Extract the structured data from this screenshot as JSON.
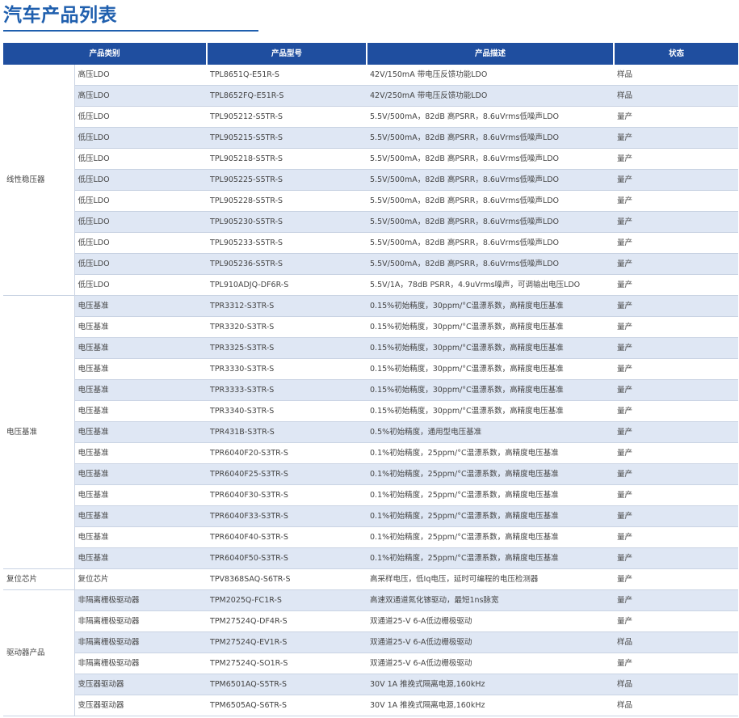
{
  "page_title": "汽车产品列表",
  "header": {
    "category": "产品类别",
    "model": "产品型号",
    "description": "产品描述",
    "status": "状态"
  },
  "groups": [
    {
      "category": "线性稳压器",
      "rows": [
        {
          "sub": "高压LDO",
          "model": "TPL8651Q-E51R-S",
          "desc": "42V/150mA 带电压反馈功能LDO",
          "status": "样品"
        },
        {
          "sub": "高压LDO",
          "model": "TPL8652FQ-E51R-S",
          "desc": "42V/250mA 带电压反馈功能LDO",
          "status": "样品"
        },
        {
          "sub": "低压LDO",
          "model": "TPL905212-S5TR-S",
          "desc": "5.5V/500mA，82dB 高PSRR，8.6uVrms低噪声LDO",
          "status": "量产"
        },
        {
          "sub": "低压LDO",
          "model": "TPL905215-S5TR-S",
          "desc": "5.5V/500mA，82dB 高PSRR，8.6uVrms低噪声LDO",
          "status": "量产"
        },
        {
          "sub": "低压LDO",
          "model": "TPL905218-S5TR-S",
          "desc": "5.5V/500mA，82dB 高PSRR，8.6uVrms低噪声LDO",
          "status": "量产"
        },
        {
          "sub": "低压LDO",
          "model": "TPL905225-S5TR-S",
          "desc": "5.5V/500mA，82dB 高PSRR，8.6uVrms低噪声LDO",
          "status": "量产"
        },
        {
          "sub": "低压LDO",
          "model": "TPL905228-S5TR-S",
          "desc": "5.5V/500mA，82dB 高PSRR，8.6uVrms低噪声LDO",
          "status": "量产"
        },
        {
          "sub": "低压LDO",
          "model": "TPL905230-S5TR-S",
          "desc": "5.5V/500mA，82dB 高PSRR，8.6uVrms低噪声LDO",
          "status": "量产"
        },
        {
          "sub": "低压LDO",
          "model": "TPL905233-S5TR-S",
          "desc": "5.5V/500mA，82dB 高PSRR，8.6uVrms低噪声LDO",
          "status": "量产"
        },
        {
          "sub": "低压LDO",
          "model": "TPL905236-S5TR-S",
          "desc": "5.5V/500mA，82dB 高PSRR，8.6uVrms低噪声LDO",
          "status": "量产"
        },
        {
          "sub": "低压LDO",
          "model": "TPL910ADJQ-DF6R-S",
          "desc": "5.5V/1A，78dB PSRR，4.9uVrms噪声，可调输出电压LDO",
          "status": "量产"
        }
      ]
    },
    {
      "category": "电压基准",
      "rows": [
        {
          "sub": "电压基准",
          "model": "TPR3312-S3TR-S",
          "desc": "0.15%初始精度，30ppm/°C温漂系数，高精度电压基准",
          "status": "量产"
        },
        {
          "sub": "电压基准",
          "model": "TPR3320-S3TR-S",
          "desc": "0.15%初始精度，30ppm/°C温漂系数，高精度电压基准",
          "status": "量产"
        },
        {
          "sub": "电压基准",
          "model": "TPR3325-S3TR-S",
          "desc": "0.15%初始精度，30ppm/°C温漂系数，高精度电压基准",
          "status": "量产"
        },
        {
          "sub": "电压基准",
          "model": "TPR3330-S3TR-S",
          "desc": "0.15%初始精度，30ppm/°C温漂系数，高精度电压基准",
          "status": "量产"
        },
        {
          "sub": "电压基准",
          "model": "TPR3333-S3TR-S",
          "desc": "0.15%初始精度，30ppm/°C温漂系数，高精度电压基准",
          "status": "量产"
        },
        {
          "sub": "电压基准",
          "model": "TPR3340-S3TR-S",
          "desc": "0.15%初始精度，30ppm/°C温漂系数，高精度电压基准",
          "status": "量产"
        },
        {
          "sub": "电压基准",
          "model": "TPR431B-S3TR-S",
          "desc": "0.5%初始精度，通用型电压基准",
          "status": "量产"
        },
        {
          "sub": "电压基准",
          "model": "TPR6040F20-S3TR-S",
          "desc": "0.1%初始精度，25ppm/°C温漂系数，高精度电压基准",
          "status": "量产"
        },
        {
          "sub": "电压基准",
          "model": "TPR6040F25-S3TR-S",
          "desc": "0.1%初始精度，25ppm/°C温漂系数，高精度电压基准",
          "status": "量产"
        },
        {
          "sub": "电压基准",
          "model": "TPR6040F30-S3TR-S",
          "desc": "0.1%初始精度，25ppm/°C温漂系数，高精度电压基准",
          "status": "量产"
        },
        {
          "sub": "电压基准",
          "model": "TPR6040F33-S3TR-S",
          "desc": "0.1%初始精度，25ppm/°C温漂系数，高精度电压基准",
          "status": "量产"
        },
        {
          "sub": "电压基准",
          "model": "TPR6040F40-S3TR-S",
          "desc": "0.1%初始精度，25ppm/°C温漂系数，高精度电压基准",
          "status": "量产"
        },
        {
          "sub": "电压基准",
          "model": "TPR6040F50-S3TR-S",
          "desc": "0.1%初始精度，25ppm/°C温漂系数，高精度电压基准",
          "status": "量产"
        }
      ]
    },
    {
      "category": "复位芯片",
      "rows": [
        {
          "sub": "复位芯片",
          "model": "TPV8368SAQ-S6TR-S",
          "desc": "高采样电压，低Iq电压，延时可编程的电压检测器",
          "status": "量产"
        }
      ]
    },
    {
      "category": "驱动器产品",
      "rows": [
        {
          "sub": "非隔离栅极驱动器",
          "model": "TPM2025Q-FC1R-S",
          "desc": "高速双通道氮化镓驱动，最短1ns脉宽",
          "status": "量产"
        },
        {
          "sub": "非隔离栅极驱动器",
          "model": "TPM27524Q-DF4R-S",
          "desc": "双通道25-V 6-A低边栅极驱动",
          "status": "量产"
        },
        {
          "sub": "非隔离栅极驱动器",
          "model": "TPM27524Q-EV1R-S",
          "desc": "双通道25-V 6-A低边栅极驱动",
          "status": "样品"
        },
        {
          "sub": "非隔离栅极驱动器",
          "model": "TPM27524Q-SO1R-S",
          "desc": "双通道25-V 6-A低边栅极驱动",
          "status": "量产"
        },
        {
          "sub": "变压器驱动器",
          "model": "TPM6501AQ-S5TR-S",
          "desc": "30V 1A 推挽式隔离电源,160kHz",
          "status": "样品"
        },
        {
          "sub": "变压器驱动器",
          "model": "TPM6505AQ-S6TR-S",
          "desc": "30V 1A 推挽式隔离电源,160kHz",
          "status": "样品"
        }
      ]
    }
  ]
}
